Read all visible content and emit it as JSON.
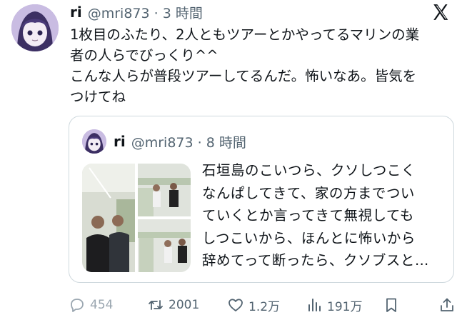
{
  "post": {
    "author_name": "ri",
    "handle_time": "@mri873 · 3 時間",
    "text_lines": [
      "1枚目のふたり、2人ともツアーとかやってるマリンの業",
      "者の人らでびっくり^^",
      "こんな人らが普段ツアーしてるんだ。怖いなあ。皆気を",
      "つけてね"
    ]
  },
  "quote": {
    "author_name": "ri",
    "handle_time": "@mri873 · 8 時間",
    "text_lines": [
      "石垣島のこいつら、クソしつこく",
      "なんぱしてきて、家の方までつい",
      "ていくとか言ってきて無視しても",
      "しつこいから、ほんとに怖いから",
      "辞めてって断ったら、クソブスと…"
    ]
  },
  "actions": {
    "reply_count": "454",
    "retweet_count": "2001",
    "like_count": "1.2万",
    "views_count": "191万"
  },
  "icons": [
    "x-logo-icon",
    "reply-icon",
    "retweet-icon",
    "heart-icon",
    "views-icon",
    "bookmark-icon",
    "share-icon"
  ],
  "colors": {
    "text": "#0f1419",
    "secondary": "#536471",
    "border": "#cfd9de",
    "avatar_bg": "#b7a8d6"
  }
}
